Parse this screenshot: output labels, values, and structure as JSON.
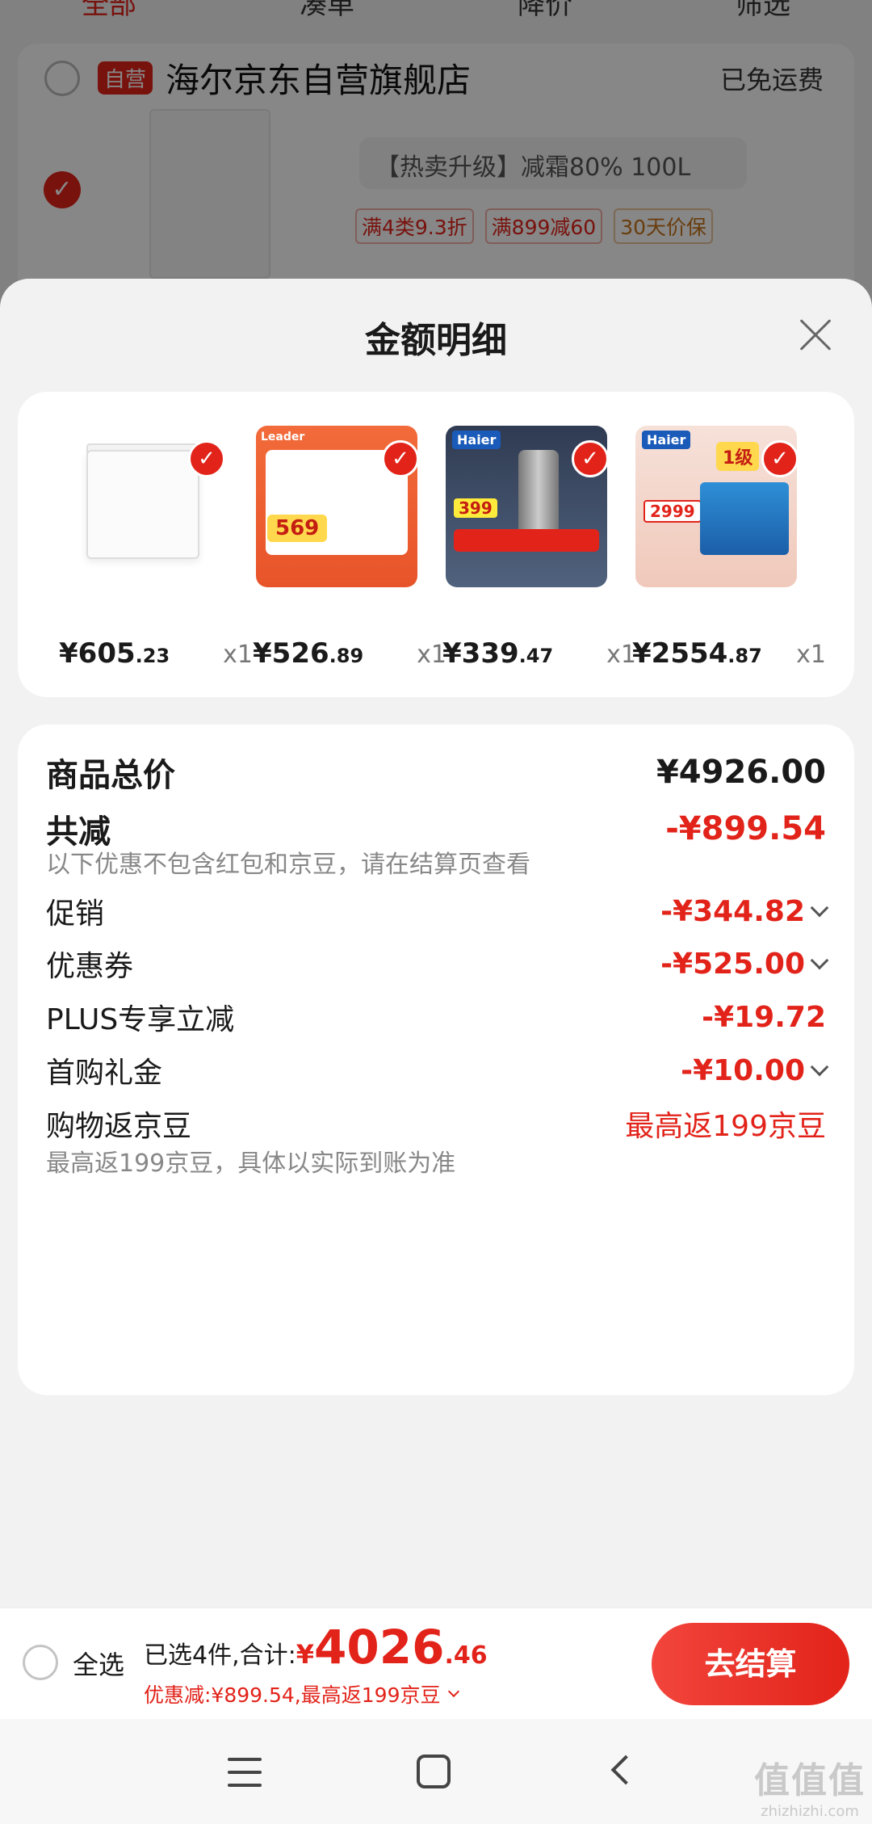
{
  "background": {
    "tabs": [
      "全部",
      "凑单",
      "降价",
      "筛选"
    ],
    "self_badge": "自营",
    "store_name": "海尔京东自营旗舰店",
    "shipping": "已免运费",
    "spec": "【热卖升级】减霜80% 100L",
    "promos": [
      "满4类9.3折",
      "满899减60",
      "30天价保"
    ]
  },
  "sheet": {
    "title": "金额明细",
    "products": [
      {
        "price_int": "¥605",
        "price_dec": ".23",
        "qty": "x1",
        "image": "chest-freezer"
      },
      {
        "price_int": "¥526",
        "price_dec": ".89",
        "qty": "x1",
        "image": "washing-machine",
        "badge": "569",
        "brand": "Leader"
      },
      {
        "price_int": "¥339",
        "price_dec": ".47",
        "qty": "x1",
        "image": "water-purifier",
        "badge": "399",
        "brand": "Haier"
      },
      {
        "price_int": "¥2554",
        "price_dec": ".87",
        "qty": "x1",
        "image": "dishwasher",
        "badge": "2999",
        "brand": "Haier"
      }
    ],
    "total_label": "商品总价",
    "total_value": "¥4926.00",
    "reduce_label": "共减",
    "reduce_value": "-¥899.54",
    "reduce_note": "以下优惠不包含红包和京豆，请在结算页查看",
    "promo_label": "促销",
    "promo_value": "-¥344.82",
    "coupon_label": "优惠券",
    "coupon_value": "-¥525.00",
    "plus_label": "PLUS专享立减",
    "plus_value": "-¥19.72",
    "gift_label": "首购礼金",
    "gift_value": "-¥10.00",
    "beans_label": "购物返京豆",
    "beans_value": "最高返199京豆",
    "beans_note": "最高返199京豆，具体以实际到账为准"
  },
  "checkout": {
    "select_all": "全选",
    "selected_label": "已选4件,合计:",
    "currency": "¥",
    "total_int": "4026",
    "total_dec": ".46",
    "discount_line": "优惠减:¥899.54,最高返199京豆",
    "button": "去结算"
  },
  "watermark": {
    "main": "值值值",
    "sub": "zhizhizhi.com"
  },
  "colors": {
    "accent": "#e2231a",
    "text": "#1a1a1a",
    "muted": "#888888"
  }
}
